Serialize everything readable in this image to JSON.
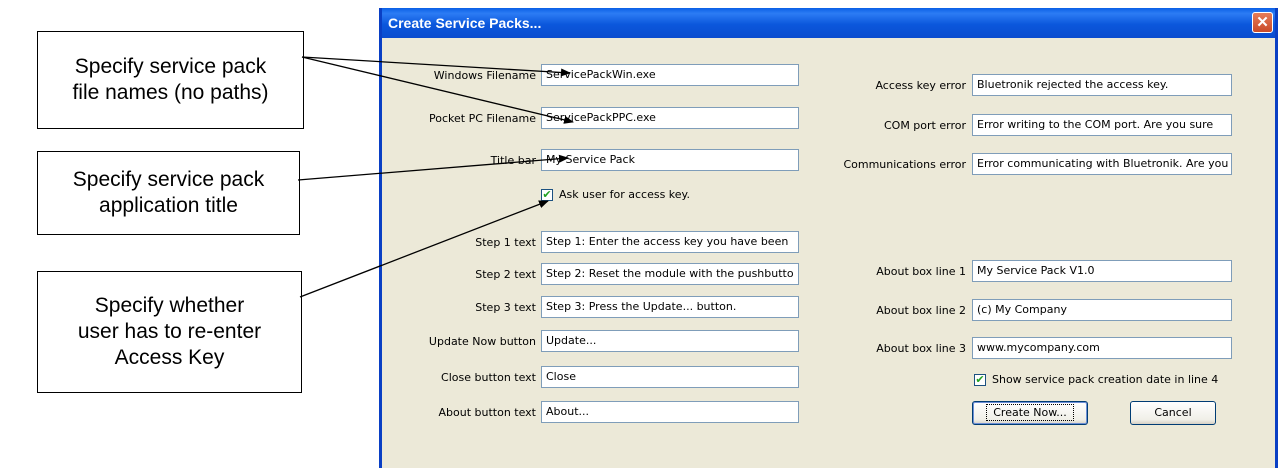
{
  "callouts": {
    "file_names": [
      "Specify service pack",
      "file names (no paths)"
    ],
    "app_title": [
      "Specify service pack",
      "application title"
    ],
    "access_key": [
      "Specify whether",
      "user has to re-enter",
      "Access Key"
    ]
  },
  "dialog": {
    "title": "Create Service Packs...",
    "close_glyph": "✕",
    "left_fields": [
      {
        "label": "Windows Filename",
        "value": "ServicePackWin.exe"
      },
      {
        "label": "Pocket PC Filename",
        "value": "ServicePackPPC.exe"
      },
      {
        "label": "Title bar",
        "value": "My Service Pack"
      },
      {
        "label": "Step 1 text",
        "value": "Step 1: Enter the access key you have been"
      },
      {
        "label": "Step 2 text",
        "value": "Step 2: Reset the module with the pushbutto"
      },
      {
        "label": "Step 3 text",
        "value": "Step 3: Press the Update... button."
      },
      {
        "label": "Update Now button",
        "value": "Update..."
      },
      {
        "label": "Close button text",
        "value": "Close"
      },
      {
        "label": "About button text",
        "value": "About..."
      }
    ],
    "right_fields": [
      {
        "label": "Access key error",
        "value": "Bluetronik rejected the access key."
      },
      {
        "label": "COM port error",
        "value": "Error writing to the COM port.  Are you sure"
      },
      {
        "label": "Communications error",
        "value": "Error communicating with Bluetronik.  Are you"
      },
      {
        "label": "About box line 1",
        "value": "My Service Pack V1.0"
      },
      {
        "label": "About box line 2",
        "value": "(c) My Company"
      },
      {
        "label": "About box line 3",
        "value": "www.mycompany.com"
      }
    ],
    "ask_access_key": {
      "label": "Ask user for access key.",
      "checked": true,
      "glyph": "✔"
    },
    "show_date": {
      "label": "Show service pack creation date in line 4",
      "checked": true,
      "glyph": "✔"
    },
    "create_button": "Create Now...",
    "cancel_button": "Cancel"
  }
}
